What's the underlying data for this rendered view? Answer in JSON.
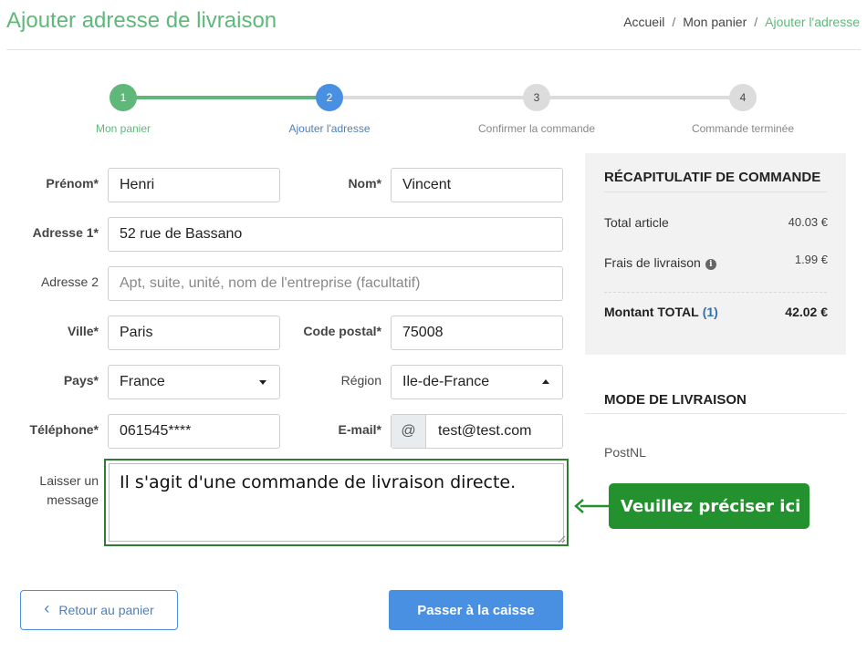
{
  "header": {
    "title": "Ajouter adresse de livraison",
    "breadcrumb": [
      "Accueil",
      "Mon panier",
      "Ajouter l'adresse"
    ],
    "breadcrumb_separator": "/"
  },
  "steps": [
    {
      "number": "1",
      "label": "Mon panier",
      "state": "done"
    },
    {
      "number": "2",
      "label": "Ajouter l'adresse",
      "state": "active"
    },
    {
      "number": "3",
      "label": "Confirmer la commande",
      "state": "pending"
    },
    {
      "number": "4",
      "label": "Commande terminée",
      "state": "pending"
    }
  ],
  "form": {
    "first_name": {
      "label": "Prénom*",
      "value": "Henri"
    },
    "last_name": {
      "label": "Nom*",
      "value": "Vincent"
    },
    "address1": {
      "label": "Adresse 1*",
      "value": "52 rue de Bassano"
    },
    "address2": {
      "label": "Adresse 2",
      "placeholder": "Apt, suite, unité, nom de l'entreprise (facultatif)"
    },
    "city": {
      "label": "Ville*",
      "value": "Paris"
    },
    "postal_code": {
      "label": "Code postal*",
      "value": "75008"
    },
    "country": {
      "label": "Pays*",
      "value": "France"
    },
    "region": {
      "label": "Région",
      "value": "Ile-de-France"
    },
    "phone": {
      "label": "Téléphone*",
      "value": "061545****"
    },
    "email": {
      "label": "E-mail*",
      "prefix": "@",
      "value": "test@test.com"
    },
    "message": {
      "label_line1": "Laisser un",
      "label_line2": "message",
      "value": "Il s'agit d'une commande de livraison directe."
    }
  },
  "callout": {
    "text": "Veuillez préciser ici"
  },
  "summary": {
    "title": "RÉCAPITULATIF DE COMMANDE",
    "subtotal_label": "Total article",
    "subtotal_value": "40.03 €",
    "shipping_label": "Frais de livraison",
    "shipping_info_icon": "i",
    "shipping_value": "1.99 €",
    "total_label": "Montant TOTAL",
    "total_count": "(1)",
    "total_value": "42.02 €"
  },
  "shipping_method": {
    "title": "MODE DE LIVRAISON",
    "option": "PostNL"
  },
  "buttons": {
    "back_icon": "‹",
    "back_label": "Retour au panier",
    "pay_label": "Passer à la caisse"
  },
  "colors": {
    "accent_green": "#5fb87a",
    "active_blue": "#4a90e2",
    "callout_green": "#23922e"
  }
}
